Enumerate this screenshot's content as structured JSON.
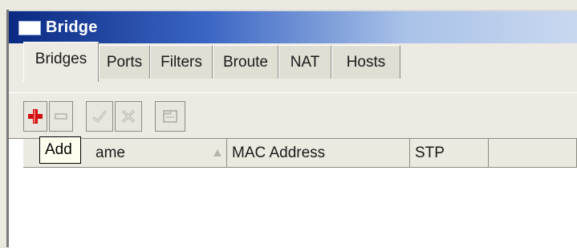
{
  "window": {
    "title": "Bridge",
    "icon": "window-icon"
  },
  "tabs": [
    {
      "label": "Bridges",
      "active": true
    },
    {
      "label": "Ports",
      "active": false
    },
    {
      "label": "Filters",
      "active": false
    },
    {
      "label": "Broute",
      "active": false
    },
    {
      "label": "NAT",
      "active": false
    },
    {
      "label": "Hosts",
      "active": false
    }
  ],
  "toolbar": {
    "buttons": [
      {
        "name": "add",
        "icon": "plus-icon",
        "color": "#cc1111"
      },
      {
        "name": "remove",
        "icon": "minus-icon"
      },
      {
        "name": "enable",
        "icon": "check-icon"
      },
      {
        "name": "disable",
        "icon": "cross-icon"
      },
      {
        "name": "comment",
        "icon": "comment-icon"
      }
    ]
  },
  "tooltip": {
    "text": "Add"
  },
  "table": {
    "columns": [
      {
        "label": "ame",
        "sorted": true
      },
      {
        "label": "MAC Address"
      },
      {
        "label": "STP"
      },
      {
        "label": ""
      }
    ],
    "rows": []
  }
}
